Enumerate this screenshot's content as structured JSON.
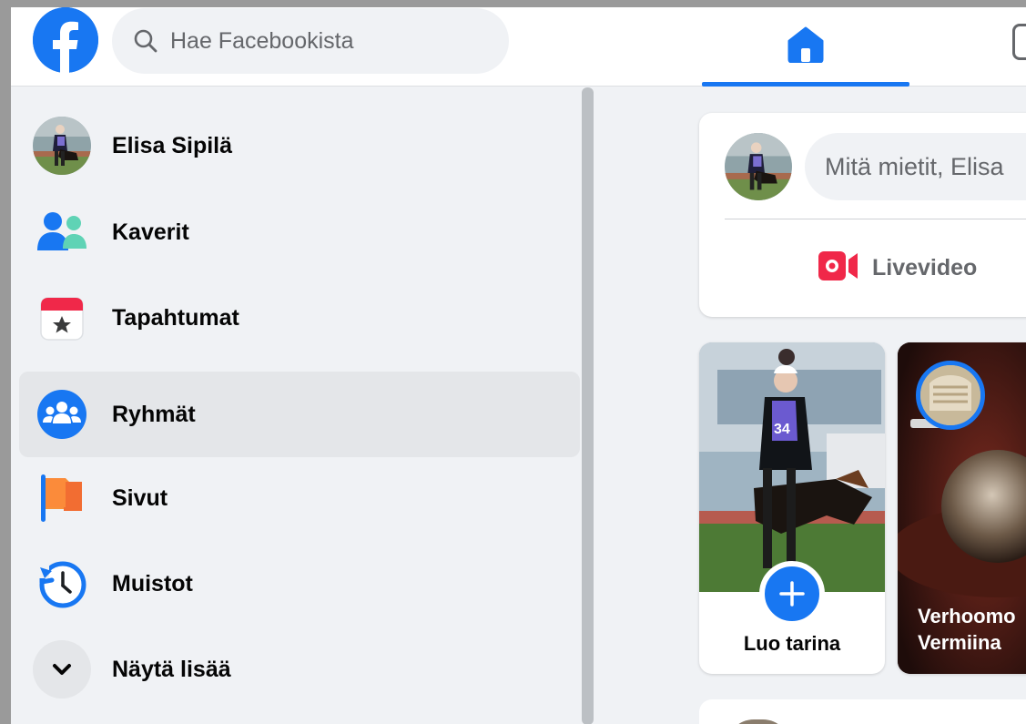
{
  "topbar": {
    "logo_icon": "facebook-logo-icon",
    "search": {
      "placeholder": "Hae Facebookista",
      "icon": "search-icon"
    },
    "nav": {
      "home_icon": "home-icon",
      "active_color": "#1877f2"
    }
  },
  "sidebar": {
    "items": [
      {
        "label": "Elisa Sipilä",
        "icon": "profile-avatar"
      },
      {
        "label": "Kaverit",
        "icon": "friends-icon"
      },
      {
        "label": "Tapahtumat",
        "icon": "calendar-star-icon"
      },
      {
        "label": "Ryhmät",
        "icon": "groups-icon"
      },
      {
        "label": "Sivut",
        "icon": "flag-icon"
      },
      {
        "label": "Muistot",
        "icon": "clock-history-icon"
      },
      {
        "label": "Näytä lisää",
        "icon": "chevron-down-icon"
      }
    ]
  },
  "composer": {
    "prompt": "Mitä mietit, Elisa",
    "live_label": "Livevideo",
    "live_icon": "live-video-icon"
  },
  "stories": [
    {
      "label": "Luo tarina",
      "icon": "plus-icon"
    },
    {
      "label_line1": "Verhoomo",
      "label_line2": "Vermiina"
    }
  ],
  "colors": {
    "brand": "#1877f2",
    "background": "#f0f2f5",
    "text": "#050505",
    "secondary_text": "#65676b",
    "live_red": "#f02849"
  }
}
